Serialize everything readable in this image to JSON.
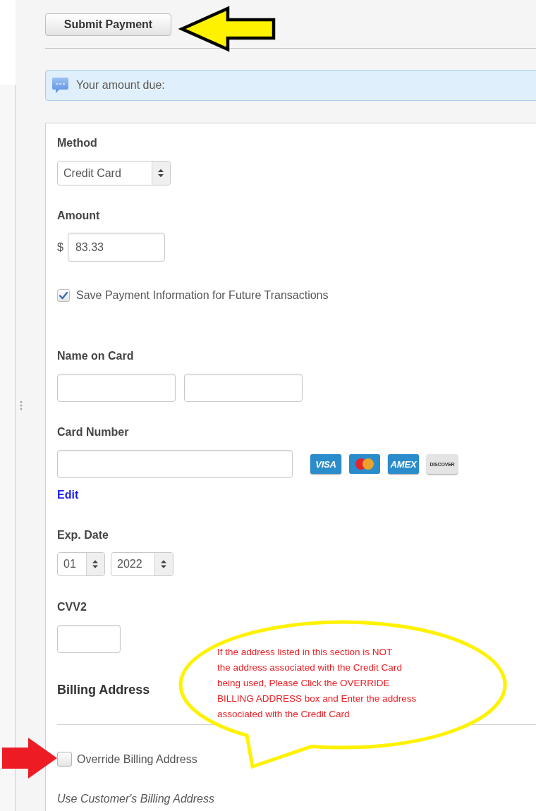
{
  "header": {
    "submit_button": "Submit Payment"
  },
  "notice": {
    "text": "Your amount due:"
  },
  "form": {
    "method": {
      "label": "Method",
      "value": "Credit Card"
    },
    "amount": {
      "label": "Amount",
      "currency": "$",
      "value": "83.33"
    },
    "save_payment": {
      "label": "Save Payment Information for Future Transactions",
      "checked": true
    },
    "name_on_card": {
      "label": "Name on Card"
    },
    "card_number": {
      "label": "Card Number",
      "card_logos": [
        {
          "kind": "text",
          "text": "VISA",
          "color": "#2b8ccb"
        },
        {
          "kind": "circles",
          "color": "#2b8ccb"
        },
        {
          "kind": "text",
          "text": "AMEX",
          "color": "#2b8ccb"
        },
        {
          "kind": "text",
          "text": "DISCOVER",
          "color": "#e4e4e4"
        }
      ],
      "edit_link": "Edit"
    },
    "exp_date": {
      "label": "Exp. Date",
      "month": "01",
      "year": "2022"
    },
    "cvv2": {
      "label": "CVV2"
    },
    "billing_address": {
      "heading": "Billing Address",
      "override": {
        "label": "Override Billing Address",
        "checked": false
      },
      "note": "Use Customer's Billing Address"
    }
  },
  "annotation": {
    "callout": "If the address listed in this section is NOT\nthe address associated with the Credit Card\nbeing used, Please Click the OVERRIDE\nBILLING ADDRESS box and Enter the address\nassociated with the Credit Card"
  }
}
